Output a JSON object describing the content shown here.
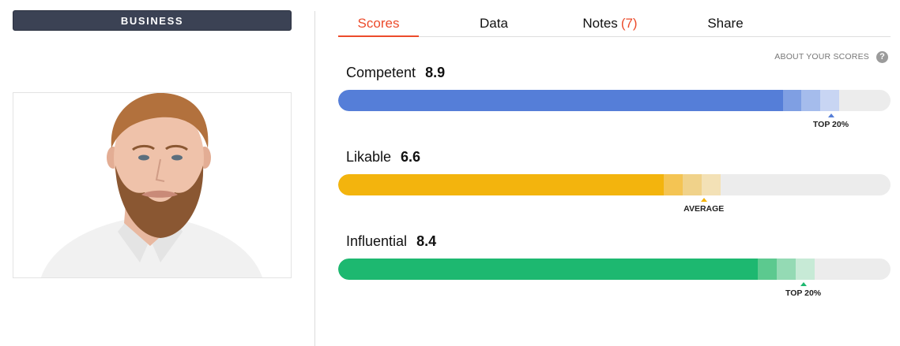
{
  "category": {
    "label": "BUSINESS"
  },
  "tabs": [
    {
      "label": "Scores",
      "active": true
    },
    {
      "label": "Data",
      "active": false
    },
    {
      "label": "Notes",
      "count": "(7)",
      "active": false
    },
    {
      "label": "Share",
      "active": false
    }
  ],
  "about": {
    "label": "ABOUT YOUR SCORES",
    "icon": "help-icon"
  },
  "photo": {
    "description_icon": "profile-photo"
  },
  "scores": [
    {
      "label": "Competent",
      "value": "8.9",
      "fill_fraction": 0.805,
      "color": "#557ed8",
      "bands": [
        "#7f9fe3",
        "#a5bcec",
        "#c8d5f3"
      ],
      "marker_fraction": 0.892,
      "marker_label": "TOP 20%"
    },
    {
      "label": "Likable",
      "value": "6.6",
      "fill_fraction": 0.59,
      "color": "#f3b40d",
      "bands": [
        "#f4c453",
        "#f0d28a",
        "#f3e1b6"
      ],
      "marker_fraction": 0.662,
      "marker_label": "AVERAGE"
    },
    {
      "label": "Influential",
      "value": "8.4",
      "fill_fraction": 0.76,
      "color": "#1db870",
      "bands": [
        "#5cc98f",
        "#94dab4",
        "#c7ead6"
      ],
      "marker_fraction": 0.842,
      "marker_label": "TOP 20%"
    }
  ]
}
